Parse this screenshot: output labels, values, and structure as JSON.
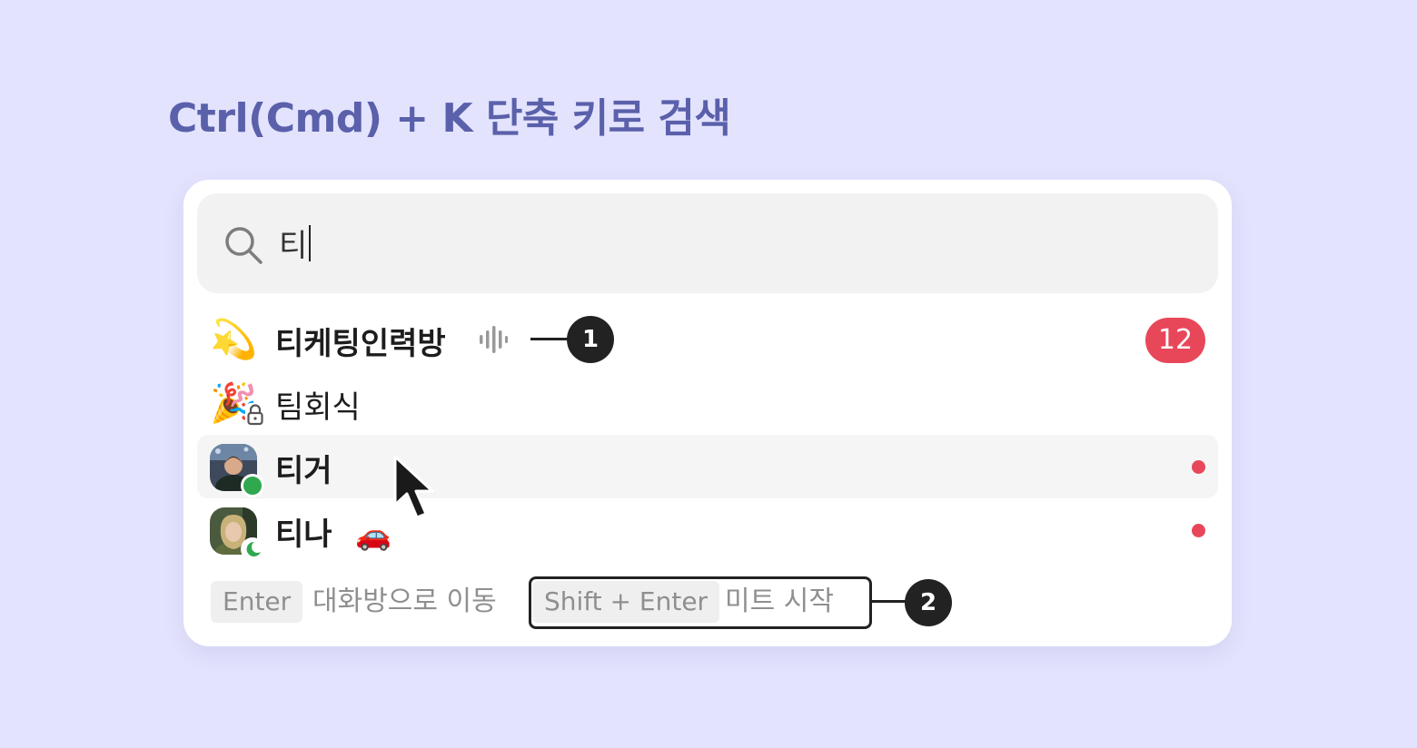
{
  "headline": "Ctrl(Cmd) + K 단축 키로 검색",
  "search": {
    "query": "티"
  },
  "results": [
    {
      "icon": "💫",
      "label": "티케팅인력방",
      "bold": true,
      "badge": "12",
      "has_audio": true
    },
    {
      "icon": "🎉",
      "label": "팀회식",
      "bold": false,
      "locked": true
    },
    {
      "label": "티거",
      "bold": true,
      "status": "online",
      "unread": true,
      "hovered": true
    },
    {
      "label": "티나",
      "bold": true,
      "status": "away",
      "status_emoji": "🚗",
      "unread": true
    }
  ],
  "footer": {
    "enter_key": "Enter",
    "enter_hint": "대화방으로 이동",
    "shift_enter_key": "Shift + Enter",
    "shift_enter_hint": "미트 시작"
  },
  "callouts": [
    "1",
    "2"
  ],
  "colors": {
    "background": "#e3e3fe",
    "headline": "#5a60aa",
    "badge": "#e8475a",
    "online": "#2fa84f"
  }
}
